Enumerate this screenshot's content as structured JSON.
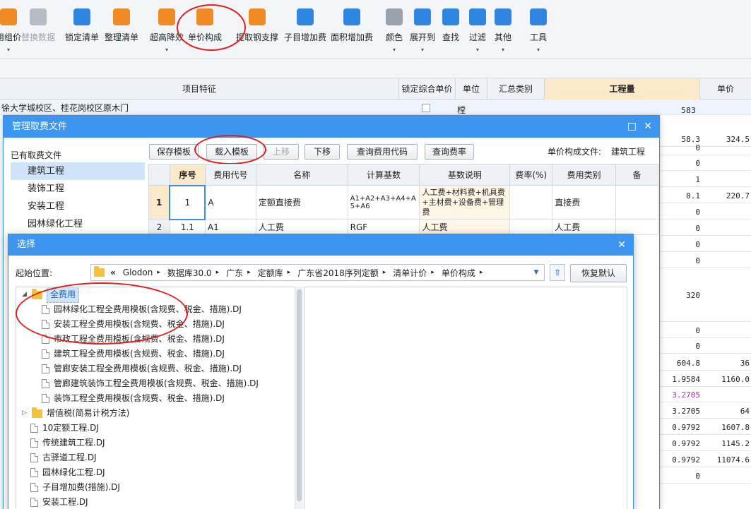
{
  "toolbar": {
    "items": [
      {
        "label": "用组价",
        "icon": "group-price-icon",
        "color": "#f08a24",
        "disabled": false
      },
      {
        "label": "替换数据",
        "icon": "replace-data-icon",
        "color": "#b5bcc4",
        "disabled": true
      },
      {
        "label": "锁定清单",
        "icon": "lock-icon",
        "color": "#2f86e0",
        "disabled": false
      },
      {
        "label": "整理清单",
        "icon": "organize-list-icon",
        "color": "#f08a24",
        "disabled": false
      },
      {
        "label": "超高降效",
        "icon": "super-height-icon",
        "color": "#f08a24",
        "disabled": false
      },
      {
        "label": "单价构成",
        "icon": "unit-price-icon",
        "color": "#f08a24",
        "disabled": false
      },
      {
        "label": "提取钢支撑",
        "icon": "steel-support-icon",
        "color": "#f08a24",
        "disabled": false
      },
      {
        "label": "子目增加费",
        "icon": "sub-item-fee-icon",
        "color": "#2f86e0",
        "disabled": false
      },
      {
        "label": "面积增加费",
        "icon": "area-fee-icon",
        "color": "#2f86e0",
        "disabled": false
      },
      {
        "label": "颜色",
        "icon": "paint-bucket-icon",
        "color": "#9aa3ad",
        "disabled": false
      },
      {
        "label": "展开到",
        "icon": "expand-to-icon",
        "color": "#2f86e0",
        "disabled": false
      },
      {
        "label": "查找",
        "icon": "binoculars-icon",
        "color": "#2f86e0",
        "disabled": false
      },
      {
        "label": "过滤",
        "icon": "filter-icon",
        "color": "#2f86e0",
        "disabled": false
      },
      {
        "label": "其他",
        "icon": "grid-icon",
        "color": "#2f86e0",
        "disabled": false
      },
      {
        "label": "工具",
        "icon": "tools-icon",
        "color": "#2f86e0",
        "disabled": false
      }
    ]
  },
  "grid": {
    "headers": [
      "项目特征",
      "锁定综合单价",
      "单位",
      "汇总类别",
      "工程量",
      "单价"
    ],
    "row1_text": "徐大学城校区、桂花岗校区原木门",
    "row1_unit": "樘",
    "row1_qty": "583",
    "rows": [
      {
        "v1": "58.3",
        "v2": "324.5"
      },
      {
        "v1": "0",
        "v2": ""
      },
      {
        "v1": "0",
        "v2": ""
      },
      {
        "v1": "1",
        "v2": ""
      },
      {
        "v1": "0.1",
        "v2": "220.7"
      },
      {
        "v1": "0",
        "v2": ""
      },
      {
        "v1": "0",
        "v2": ""
      },
      {
        "v1": "0",
        "v2": ""
      },
      {
        "v1": "0",
        "v2": ""
      },
      {
        "v1": "320",
        "v2": ""
      },
      {
        "v1": "0",
        "v2": ""
      },
      {
        "v1": "0",
        "v2": ""
      },
      {
        "v1": "604.8",
        "v2": "36"
      },
      {
        "v1": "1.9584",
        "v2": "1160.0"
      },
      {
        "v1": "3.2705",
        "v2": ""
      },
      {
        "v1": "3.2705",
        "v2": "64"
      },
      {
        "v1": "0.9792",
        "v2": "1607.8"
      },
      {
        "v1": "0.9792",
        "v2": "1145.2"
      },
      {
        "v1": "0.9792",
        "v2": "11074.6"
      },
      {
        "v1": "0",
        "v2": ""
      }
    ]
  },
  "dialog_fee": {
    "title": "管理取费文件",
    "left_label": "已有取费文件",
    "categories": [
      "建筑工程",
      "装饰工程",
      "安装工程",
      "园林绿化工程"
    ],
    "buttons": {
      "save": "保存模板",
      "load": "载入模板",
      "up": "上移",
      "down": "下移",
      "query_code": "查询费用代码",
      "query_rate": "查询费率"
    },
    "info_label": "单价构成文件:",
    "info_value": "建筑工程",
    "headers": [
      "序号",
      "费用代号",
      "名称",
      "计算基数",
      "基数说明",
      "费率(%)",
      "费用类别",
      "备"
    ],
    "rows": [
      {
        "idx": "1",
        "seq": "1",
        "code": "A",
        "name": "定额直接费",
        "base": "A1+A2+A3+A4+A5+A6",
        "desc": "人工费+材料费+机具费+主材费+设备费+管理费",
        "rate": "",
        "cat": "直接费"
      },
      {
        "idx": "2",
        "seq": "1.1",
        "code": "A1",
        "name": "人工费",
        "base": "RGF",
        "desc": "人工费",
        "rate": "",
        "cat": "人工费"
      }
    ]
  },
  "dialog_select": {
    "title": "选择",
    "start_label": "起始位置:",
    "path": [
      "Glodon",
      "数据库30.0",
      "广东",
      "定额库",
      "广东省2018序列定额",
      "清单计价",
      "单价构成"
    ],
    "restore_button": "恢复默认",
    "tree": [
      {
        "type": "folder",
        "label": "全费用",
        "indent": 0,
        "expanded": true,
        "selected": true
      },
      {
        "type": "file",
        "label": "园林绿化工程全费用模板(含规费、税金、措施).DJ",
        "indent": 1
      },
      {
        "type": "file",
        "label": "安装工程全费用模板(含规费、税金、措施).DJ",
        "indent": 1
      },
      {
        "type": "file",
        "label": "市政工程全费用模板(含规费、税金、措施).DJ",
        "indent": 1
      },
      {
        "type": "file",
        "label": "建筑工程全费用模板(含规费、税金、措施).DJ",
        "indent": 1
      },
      {
        "type": "file",
        "label": "管廊安装工程全费用模板(含规费、税金、措施).DJ",
        "indent": 1
      },
      {
        "type": "file",
        "label": "管廊建筑装饰工程全费用模板(含规费、税金、措施).DJ",
        "indent": 1
      },
      {
        "type": "file",
        "label": "装饰工程全费用模板(含规费、税金、措施).DJ",
        "indent": 1
      },
      {
        "type": "folder",
        "label": "增值税(简易计税方法)",
        "indent": 0,
        "expanded": false
      },
      {
        "type": "file",
        "label": "10定额工程.DJ",
        "indent": 0
      },
      {
        "type": "file",
        "label": "传统建筑工程.DJ",
        "indent": 0
      },
      {
        "type": "file",
        "label": "古驿道工程.DJ",
        "indent": 0
      },
      {
        "type": "file",
        "label": "园林绿化工程.DJ",
        "indent": 0
      },
      {
        "type": "file",
        "label": "子目增加费(措施).DJ",
        "indent": 0
      },
      {
        "type": "file",
        "label": "安装工程.DJ",
        "indent": 0
      }
    ]
  }
}
